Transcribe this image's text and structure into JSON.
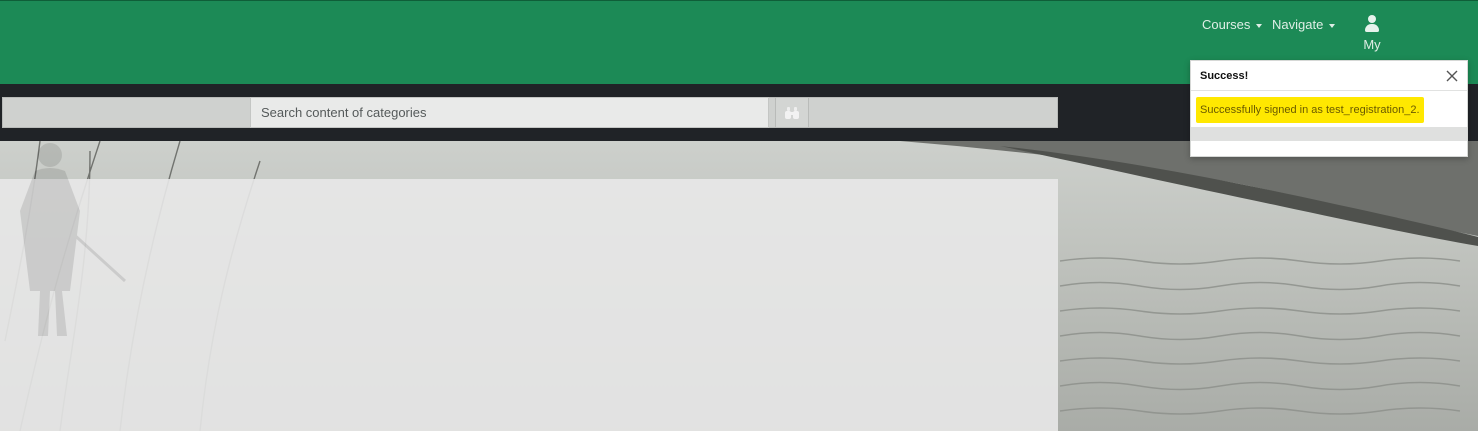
{
  "navbar": {
    "courses_label": "Courses",
    "navigate_label": "Navigate",
    "account_label": "My",
    "bg_color": "#1c8a56"
  },
  "search": {
    "placeholder": "Search content of categories",
    "button_icon": "binoculars-icon"
  },
  "toast": {
    "title": "Success!",
    "message": "Successfully signed in as test_registration_2.",
    "highlight_color": "#ffe800"
  }
}
